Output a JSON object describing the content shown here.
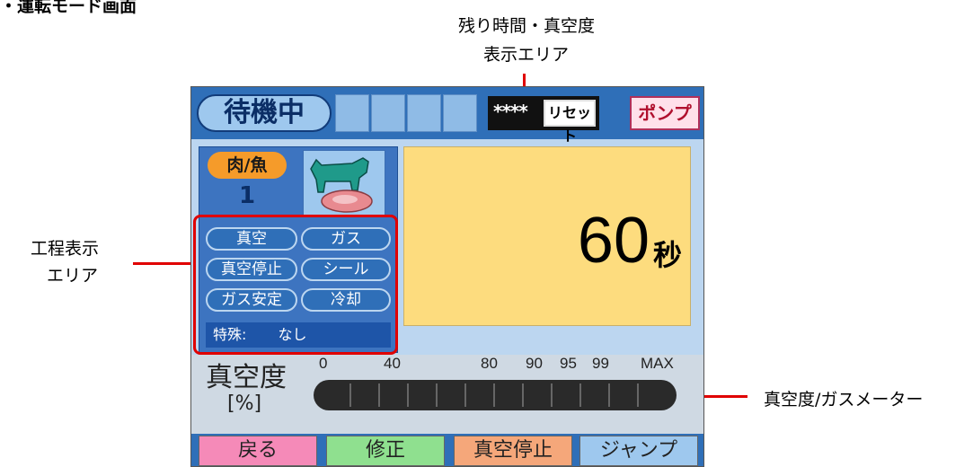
{
  "annotations": {
    "title": "・運転モード画面",
    "remaining_display": [
      "残り時間・真空度",
      "表示エリア"
    ],
    "process_display": [
      "工程表示",
      "エリア"
    ],
    "meter_label": "真空度/ガスメーター"
  },
  "device": {
    "status": "待機中",
    "password_mask": "****",
    "reset_button": "リセット",
    "pump_button": "ポンプ",
    "category_label": "肉/魚",
    "program_number": "1",
    "process_steps": [
      "真空",
      "ガス",
      "真空停止",
      "シール",
      "ガス安定",
      "冷却"
    ],
    "special_label": "特殊:",
    "special_value": "なし",
    "timer_value": "60",
    "timer_unit": "秒",
    "meter_title": "真空度",
    "meter_unit": "[%]",
    "meter_ticks": [
      "0",
      "40",
      "80",
      "90",
      "95",
      "99",
      "MAX"
    ],
    "meter_level": 0,
    "footer_buttons": [
      "戻る",
      "修正",
      "真空停止",
      "ジャンプ"
    ]
  },
  "colors": {
    "annotation_red": "#e00000",
    "header_blue": "#2f6fb8",
    "timer_bg": "#fddc7e",
    "category_orange": "#f59b2a",
    "back_pink": "#f58ab8",
    "correct_green": "#8fe08f",
    "stop_orange": "#f5a77a",
    "jump_blue": "#9ec8ee"
  },
  "icons": {
    "category_icon": "cow-meat-icon"
  }
}
